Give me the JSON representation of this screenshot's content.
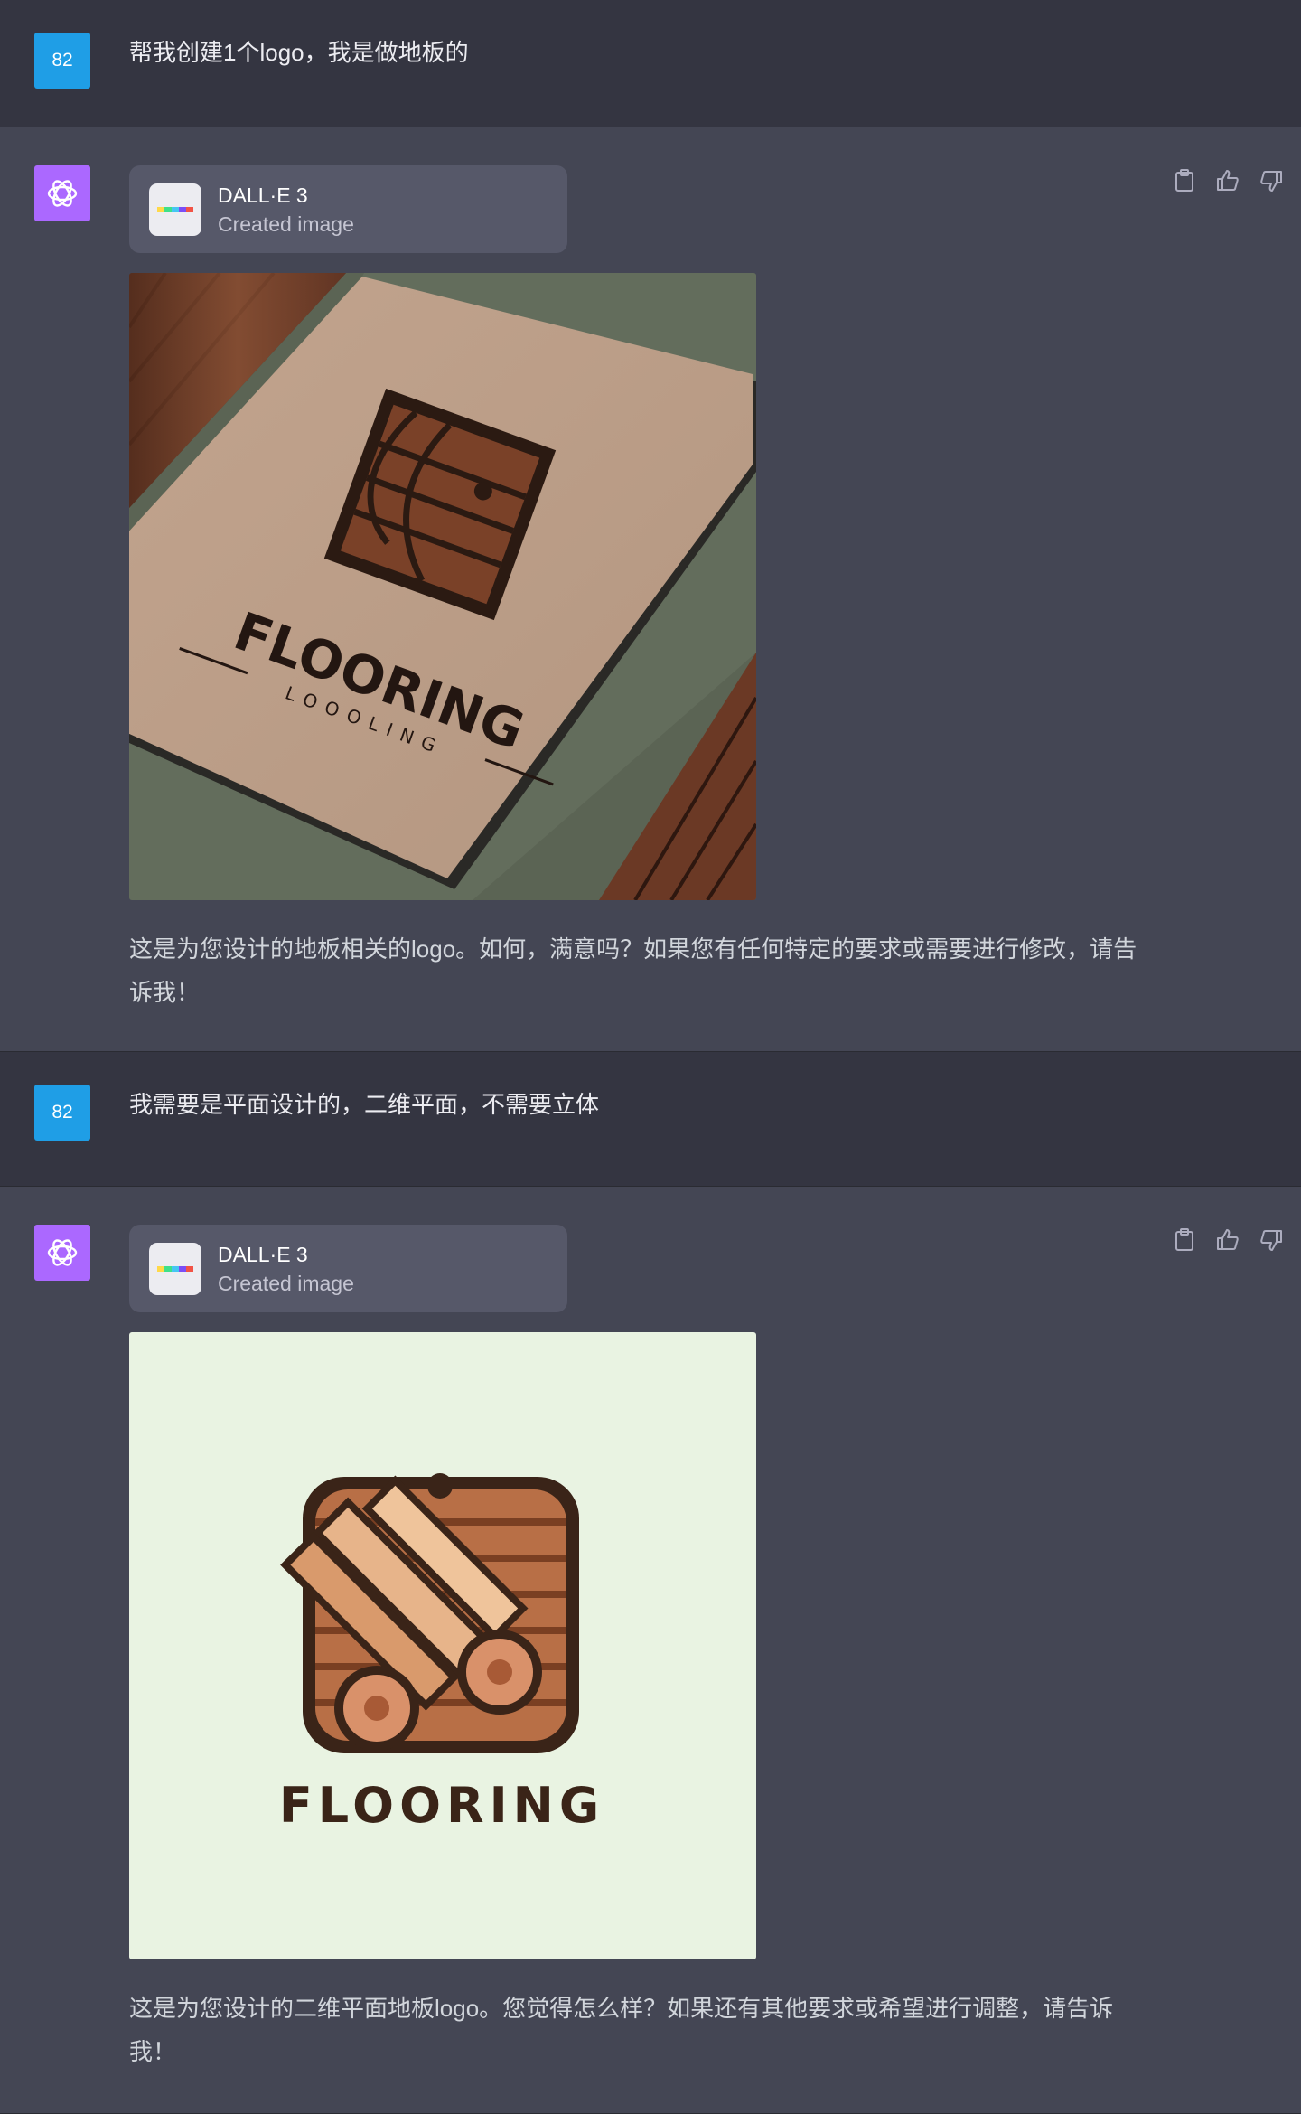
{
  "user_avatar": "82",
  "turns": [
    {
      "role": "user",
      "text": "帮我创建1个logo，我是做地板的"
    },
    {
      "role": "assistant",
      "tool": {
        "name": "DALL·E 3",
        "status": "Created image"
      },
      "image": {
        "wordmark": "FLOORING",
        "sub_wordmark": "LOOOLING"
      },
      "text": "这是为您设计的地板相关的logo。如何，满意吗？如果您有任何特定的要求或需要进行修改，请告诉我！"
    },
    {
      "role": "user",
      "text": "我需要是平面设计的，二维平面，不需要立体"
    },
    {
      "role": "assistant",
      "tool": {
        "name": "DALL·E 3",
        "status": "Created image"
      },
      "image": {
        "wordmark": "FLOORING"
      },
      "text": "这是为您设计的二维平面地板logo。您觉得怎么样？如果还有其他要求或希望进行调整，请告诉我！"
    }
  ],
  "icons": {
    "bot_avatar": "openai-logo-icon",
    "copy": "clipboard-icon",
    "like": "thumbs-up-icon",
    "dislike": "thumbs-down-icon",
    "dalle": "dalle-color-bar-icon"
  },
  "colors": {
    "page_bg": "#444654",
    "user_row_bg": "#343541",
    "user_avatar": "#1f9ee6",
    "bot_avatar": "#ab68ff",
    "tool_card": "#565869"
  }
}
